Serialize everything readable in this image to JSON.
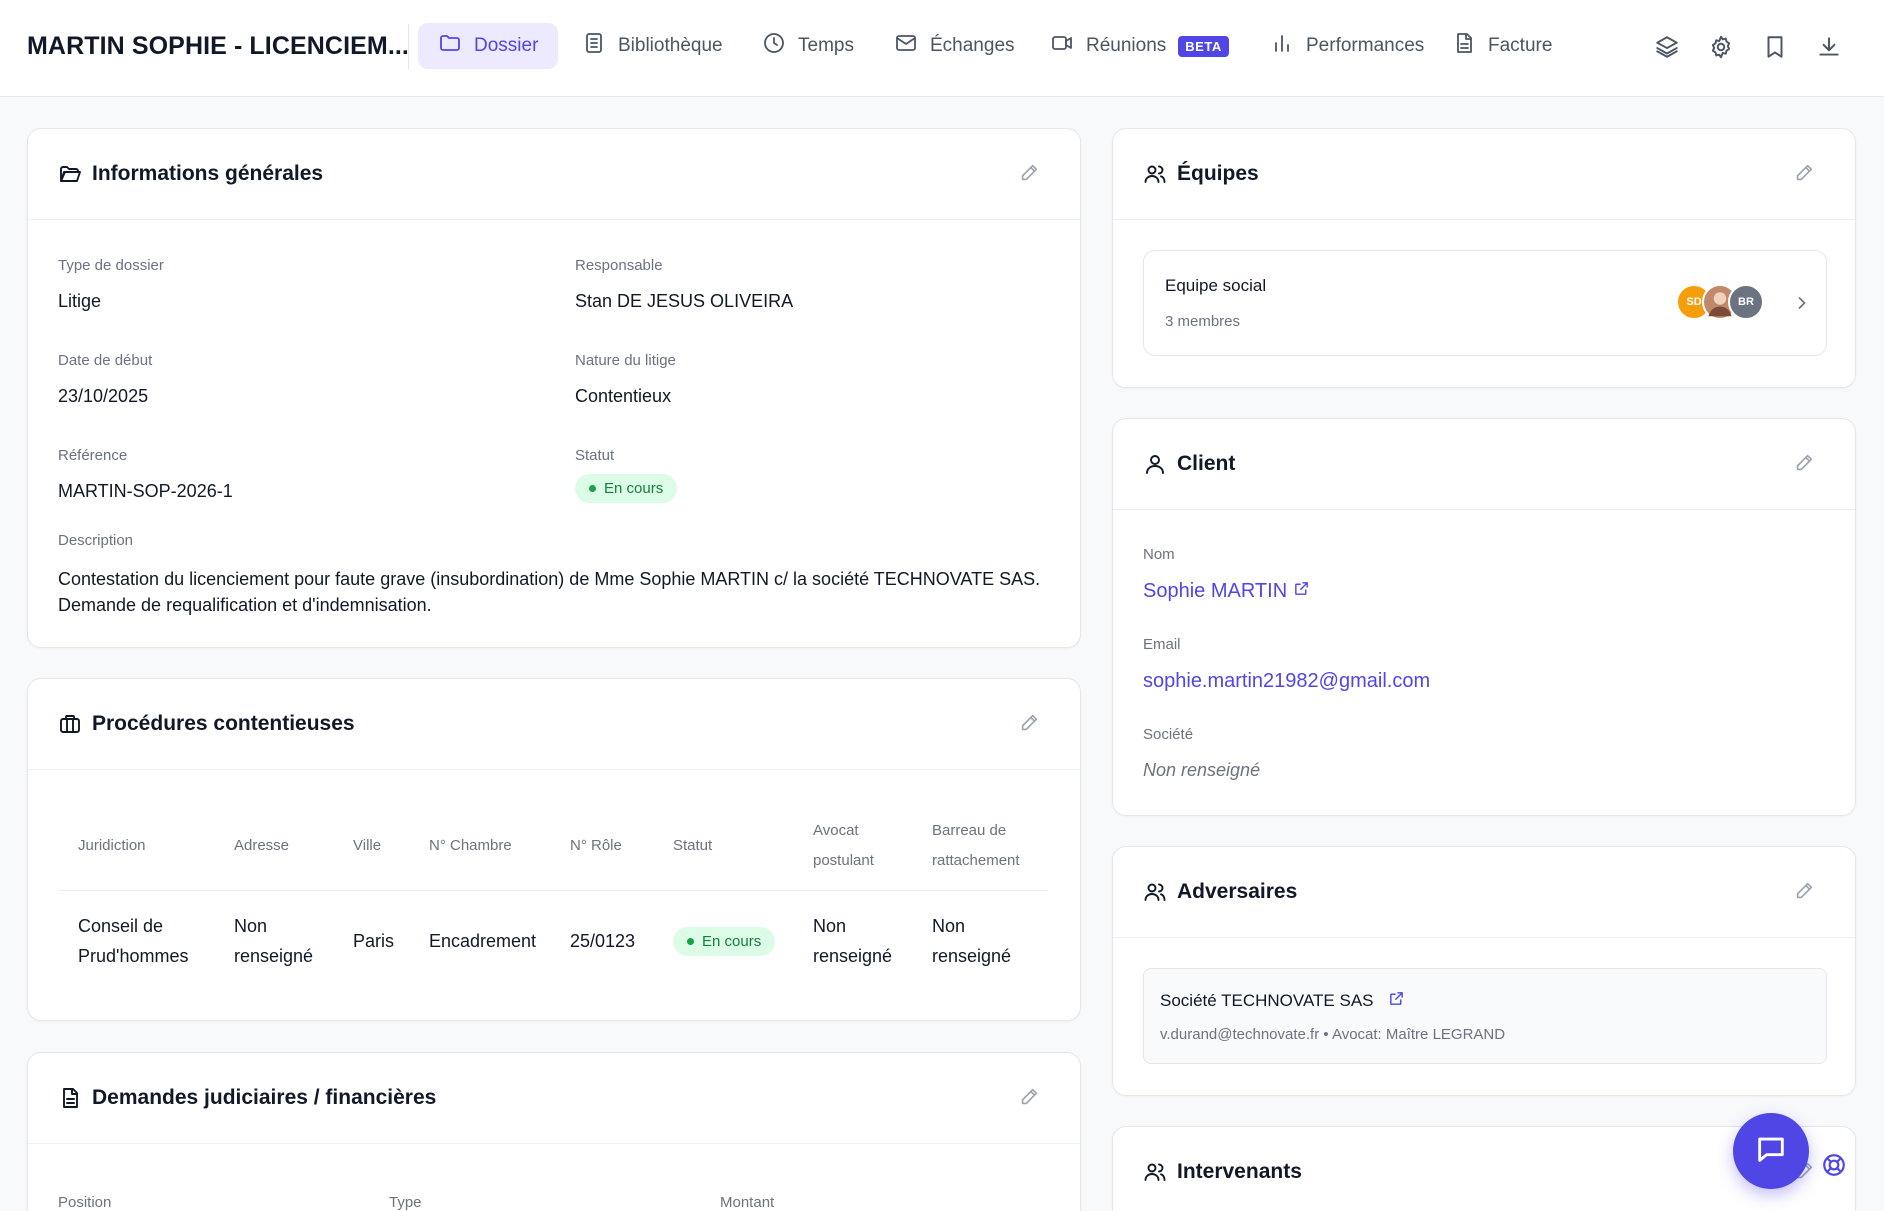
{
  "header": {
    "case_title": "MARTIN SOPHIE - LICENCIEM...",
    "tabs": [
      {
        "label": "Dossier",
        "icon": "folder-icon",
        "active": true
      },
      {
        "label": "Bibliothèque",
        "icon": "document-icon"
      },
      {
        "label": "Temps",
        "icon": "clock-icon"
      },
      {
        "label": "Échanges",
        "icon": "mail-icon"
      },
      {
        "label": "Réunions",
        "icon": "video-icon",
        "badge": "BETA"
      },
      {
        "label": "Performances",
        "icon": "bar-chart-icon"
      },
      {
        "label": "Facture",
        "icon": "invoice-icon"
      }
    ],
    "actions": [
      "layers-icon",
      "gear-icon",
      "bookmark-icon",
      "download-icon"
    ]
  },
  "general": {
    "title": "Informations générales",
    "type_label": "Type de dossier",
    "type_value": "Litige",
    "responsable_label": "Responsable",
    "responsable_value": "Stan DE JESUS OLIVEIRA",
    "date_label": "Date de début",
    "date_value": "23/10/2025",
    "nature_label": "Nature du litige",
    "nature_value": "Contentieux",
    "ref_label": "Référence",
    "ref_value": "MARTIN-SOP-2026-1",
    "status_label": "Statut",
    "status_value": "En cours",
    "desc_label": "Description",
    "desc_line1": "Contestation du licenciement pour faute grave (insubordination) de Mme Sophie MARTIN c/ la société TECHNOVATE SAS.",
    "desc_line2": "Demande de requalification et d'indemnisation."
  },
  "procedures": {
    "title": "Procédures contentieuses",
    "columns": [
      "Juridiction",
      "Adresse",
      "Ville",
      "N° Chambre",
      "N° Rôle",
      "Statut",
      "Avocat",
      "postulant",
      "Barreau de",
      "rattachement"
    ],
    "row": {
      "juridiction_1": "Conseil de",
      "juridiction_2": "Prud'hommes",
      "adresse_1": "Non",
      "adresse_2": "renseigné",
      "ville": "Paris",
      "chambre": "Encadrement",
      "role": "25/0123",
      "statut": "En cours",
      "avocat_1": "Non",
      "avocat_2": "renseigné",
      "barreau_1": "Non",
      "barreau_2": "renseigné"
    }
  },
  "demandes": {
    "title": "Demandes judiciaires / financières",
    "columns": [
      "Position",
      "Type",
      "Montant"
    ]
  },
  "equipes": {
    "title": "Équipes",
    "team_name": "Equipe social",
    "team_count": "3 membres",
    "avatars": [
      {
        "initials": "SD",
        "color": "#f59e0b"
      },
      {
        "initials": "",
        "color": "#c08a6a"
      },
      {
        "initials": "BR",
        "color": "#6b7280"
      }
    ]
  },
  "client": {
    "title": "Client",
    "name_label": "Nom",
    "name_value": "Sophie MARTIN",
    "email_label": "Email",
    "email_value": "sophie.martin21982@gmail.com",
    "company_label": "Société",
    "company_value": "Non renseigné"
  },
  "adversaires": {
    "title": "Adversaires",
    "name": "Société TECHNOVATE SAS",
    "detail": "v.durand@technovate.fr • Avocat: Maître LEGRAND"
  },
  "intervenants": {
    "title": "Intervenants"
  },
  "colors": {
    "accent": "#4f46e5",
    "status_green_bg": "#dcfce7",
    "status_green_text": "#15803d"
  }
}
